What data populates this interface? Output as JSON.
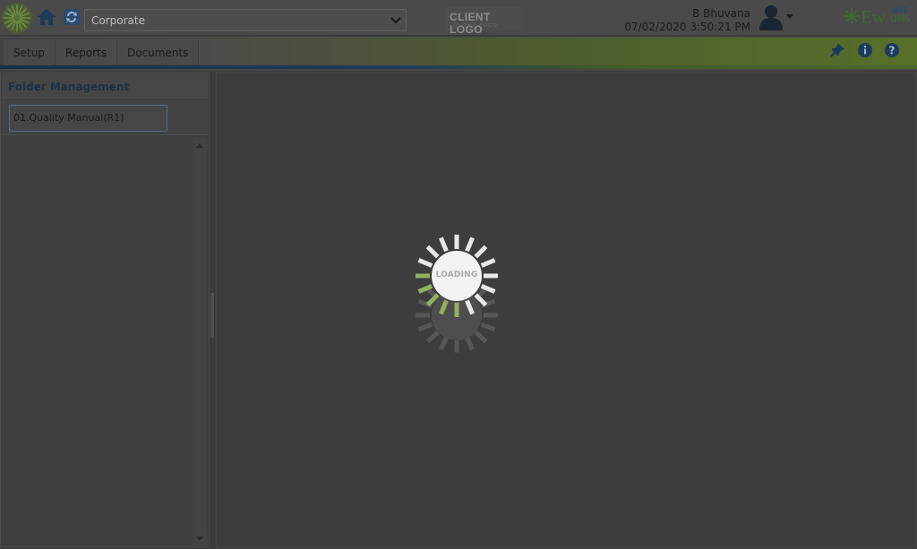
{
  "header": {
    "org_select_value": "Corporate",
    "client_logo_text": "CLIENT LOGO",
    "client_logo_tagline": "CLIENT LOGO",
    "user_name": "B Bhuvana",
    "datetime": "07/02/2020 3:50:21 PM",
    "brand_ew": "Ew",
    "brand_ims": "IMS",
    "brand_qms": "QMS",
    "icons": {
      "app_logo": "app-flower-logo",
      "home": "home-icon",
      "refresh": "refresh-icon",
      "user": "user-avatar-icon",
      "pin": "pin-icon",
      "info": "info-icon",
      "help": "help-icon"
    }
  },
  "menu": {
    "items": [
      "Setup",
      "Reports",
      "Documents"
    ]
  },
  "left_panel": {
    "title": "Folder Management",
    "folder_input_value": "01.Quality Manual(R1)"
  },
  "loader": {
    "text": "LOADING"
  },
  "colors": {
    "accent_green": "#5b7a2f",
    "accent_blue": "#1c3a5a",
    "overlay": "#3e3e3e"
  }
}
